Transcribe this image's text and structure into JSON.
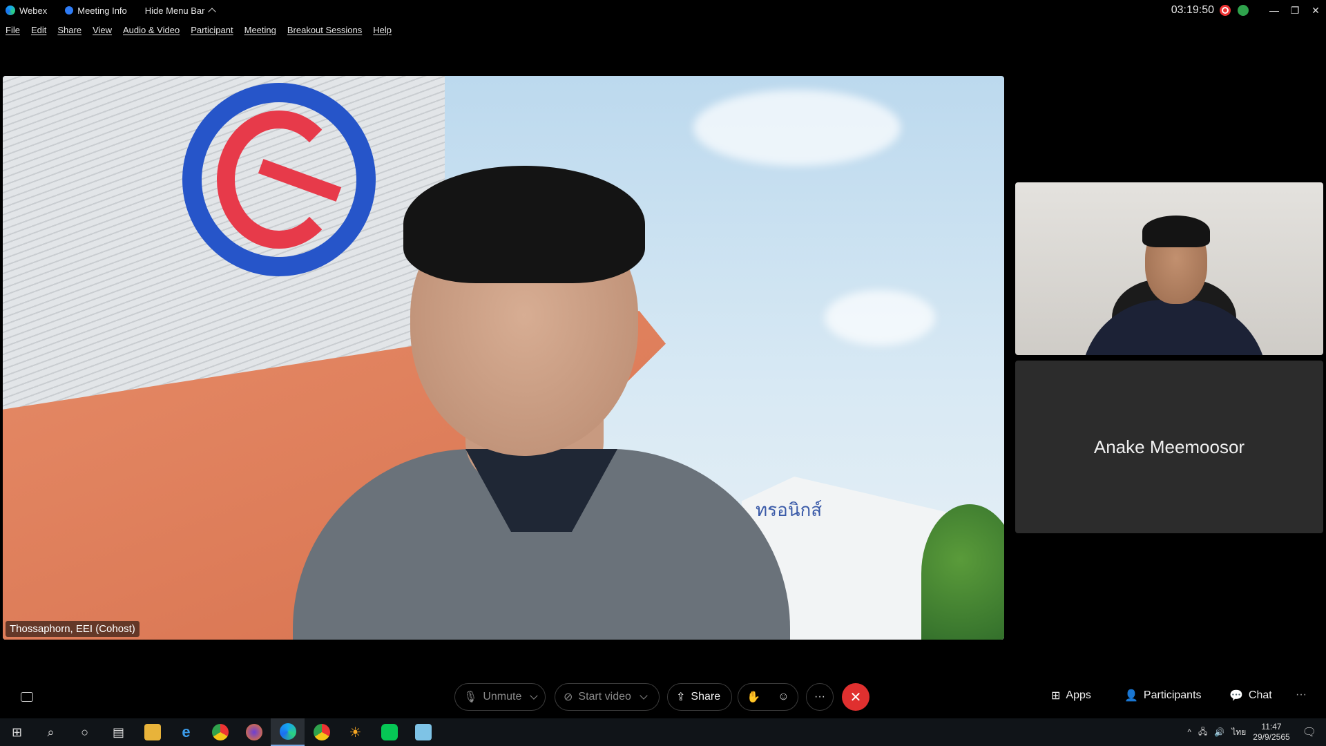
{
  "titlebar": {
    "app_name": "Webex",
    "meeting_info": "Meeting Info",
    "hide_menu_bar": "Hide Menu Bar",
    "timer": "03:19:50"
  },
  "menubar": {
    "items": [
      "File",
      "Edit",
      "Share",
      "View",
      "Audio & Video",
      "Participant",
      "Meeting",
      "Breakout Sessions",
      "Help"
    ]
  },
  "main_video": {
    "participant_name": "Thossaphorn, EEI (Cohost)",
    "background_sign": "ทรอนิกส์"
  },
  "side_tiles": {
    "tile2_name": "Anake Meemoosor"
  },
  "controls": {
    "unmute": "Unmute",
    "start_video": "Start video",
    "share": "Share",
    "apps": "Apps",
    "participants": "Participants",
    "chat": "Chat"
  },
  "taskbar": {
    "time": "11:47",
    "date": "29/9/2565",
    "language": "ไทย"
  },
  "colors": {
    "end_call": "#e0302f",
    "recording": "#ee3333",
    "background": "#000000"
  }
}
